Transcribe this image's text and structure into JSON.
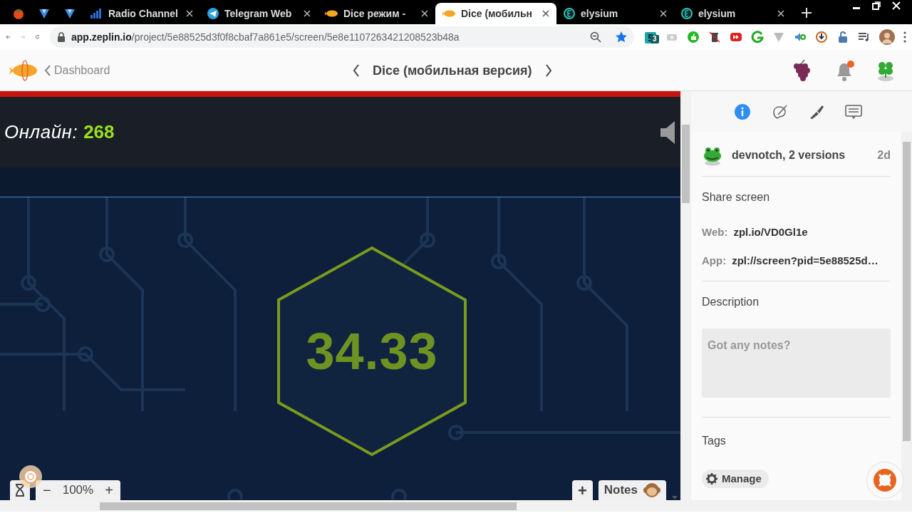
{
  "browser": {
    "tabs": [
      {
        "selected": false
      },
      {
        "selected": false
      },
      {
        "selected": false
      },
      {
        "title": "Radio Channel",
        "selected": false
      },
      {
        "title": "Telegram Web",
        "selected": false
      },
      {
        "title": "Dice режим - ",
        "selected": false
      },
      {
        "title": "Dice (мобильн",
        "selected": true
      },
      {
        "title": "elysium",
        "selected": false
      },
      {
        "title": "elysium",
        "selected": false
      }
    ],
    "url": "**app.zeplin.io**/project/5e88525d3f0f8cbaf7a861e5/screen/5e8e1107263421208523b48a",
    "extension_badge": "3"
  },
  "header": {
    "back_label": "Dashboard",
    "screen_title": "Dice (мобильная версия)"
  },
  "canvas": {
    "online_label": "Онлайн:",
    "online_count": "268",
    "roll_value": "34.33",
    "zoom": "100%",
    "zoom_out": "−",
    "zoom_in": "+",
    "add": "+",
    "notes": "Notes"
  },
  "sidebar": {
    "tabs": [
      {
        "selected": true
      },
      {
        "selected": false
      },
      {
        "selected": false
      },
      {
        "selected": false
      }
    ],
    "version": {
      "author": "devnotch, 2 versions",
      "age": "2d"
    },
    "share_title": "Share screen",
    "links": [
      {
        "label": "Web:",
        "value": "zpl.io/VD0Gl1e"
      },
      {
        "label": "App:",
        "value": "zpl://screen?pid=5e88525d…"
      }
    ],
    "description_title": "Description",
    "description": {
      "placeholder": "Got any notes?"
    },
    "tags_title": "Tags",
    "manage": "Manage"
  }
}
